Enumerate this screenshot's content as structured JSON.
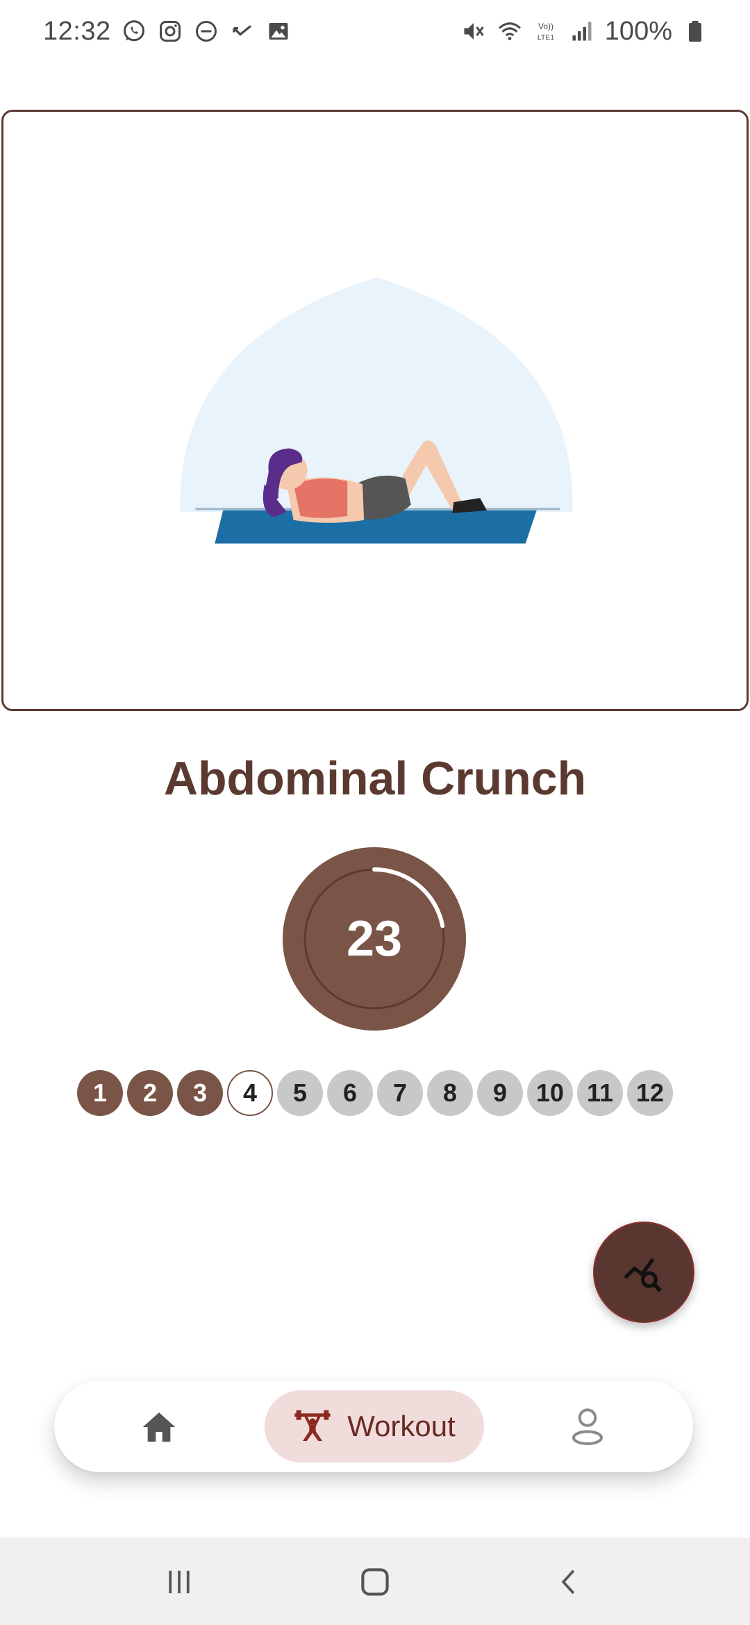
{
  "status_bar": {
    "time": "12:32",
    "battery": "100%",
    "left_icons": [
      "whatsapp-icon",
      "instagram-icon",
      "do-not-disturb-icon",
      "missed-call-icon",
      "gallery-icon"
    ],
    "right_icons": [
      "mute-icon",
      "wifi-icon",
      "volte-icon",
      "signal-icon",
      "battery-icon"
    ]
  },
  "exercise": {
    "name": "Abdominal Crunch",
    "illustration": "woman-doing-crunch-illustration"
  },
  "timer": {
    "value": "23",
    "progress": 0.22
  },
  "steps": {
    "items": [
      {
        "label": "1",
        "state": "done"
      },
      {
        "label": "2",
        "state": "done"
      },
      {
        "label": "3",
        "state": "done"
      },
      {
        "label": "4",
        "state": "current"
      },
      {
        "label": "5",
        "state": "todo"
      },
      {
        "label": "6",
        "state": "todo"
      },
      {
        "label": "7",
        "state": "todo"
      },
      {
        "label": "8",
        "state": "todo"
      },
      {
        "label": "9",
        "state": "todo"
      },
      {
        "label": "10",
        "state": "todo"
      },
      {
        "label": "11",
        "state": "todo"
      },
      {
        "label": "12",
        "state": "todo"
      }
    ]
  },
  "fab": {
    "icon": "chart-search-icon"
  },
  "bottom_nav": {
    "home_icon": "home-icon",
    "workout_label": "Workout",
    "workout_icon": "weightlifter-icon",
    "profile_icon": "profile-icon",
    "active": "workout"
  },
  "colors": {
    "primary": "#7a5547",
    "title": "#5a3a30",
    "fab": "#5a3630",
    "active_pill": "#f0dddb",
    "inactive_step": "#c8c8c8"
  }
}
